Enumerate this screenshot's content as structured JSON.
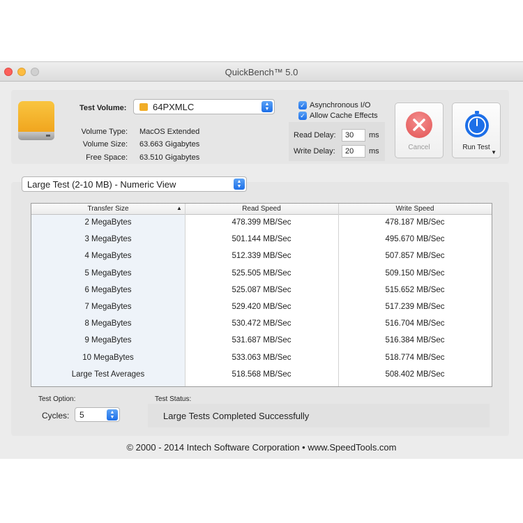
{
  "window": {
    "title": "QuickBench™ 5.0"
  },
  "volume": {
    "label": "Test Volume:",
    "selected": "64PXMLC",
    "type_label": "Volume Type:",
    "type_value": "MacOS Extended",
    "size_label": "Volume Size:",
    "size_value": "63.663 Gigabytes",
    "free_label": "Free Space:",
    "free_value": "63.510 Gigabytes"
  },
  "options": {
    "async_label": "Asynchronous I/O",
    "cache_label": "Allow Cache Effects",
    "async_checked": true,
    "cache_checked": true,
    "read_delay_label": "Read Delay:",
    "read_delay_value": "30",
    "write_delay_label": "Write Delay:",
    "write_delay_value": "20",
    "unit": "ms"
  },
  "buttons": {
    "cancel_label": "Cancel",
    "run_label": "Run Test"
  },
  "view_select": {
    "selected": "Large Test (2-10 MB) - Numeric View"
  },
  "table": {
    "headers": [
      "Transfer Size",
      "Read Speed",
      "Write Speed"
    ],
    "rows": [
      [
        "2 MegaBytes",
        "478.399 MB/Sec",
        "478.187 MB/Sec"
      ],
      [
        "3 MegaBytes",
        "501.144 MB/Sec",
        "495.670 MB/Sec"
      ],
      [
        "4 MegaBytes",
        "512.339 MB/Sec",
        "507.857 MB/Sec"
      ],
      [
        "5 MegaBytes",
        "525.505 MB/Sec",
        "509.150 MB/Sec"
      ],
      [
        "6 MegaBytes",
        "525.087 MB/Sec",
        "515.652 MB/Sec"
      ],
      [
        "7 MegaBytes",
        "529.420 MB/Sec",
        "517.239 MB/Sec"
      ],
      [
        "8 MegaBytes",
        "530.472 MB/Sec",
        "516.704 MB/Sec"
      ],
      [
        "9 MegaBytes",
        "531.687 MB/Sec",
        "516.384 MB/Sec"
      ],
      [
        "10 MegaBytes",
        "533.063 MB/Sec",
        "518.774 MB/Sec"
      ],
      [
        "Large Test Averages",
        "518.568 MB/Sec",
        "508.402 MB/Sec"
      ]
    ]
  },
  "test_option": {
    "label": "Test Option:",
    "cycles_label": "Cycles:",
    "cycles_value": "5"
  },
  "test_status": {
    "label": "Test Status:",
    "value": "Large Tests Completed Successfully"
  },
  "footer": {
    "text": "© 2000 - 2014 Intech Software Corporation • www.SpeedTools.com"
  },
  "colors": {
    "accent": "#1d6fe8",
    "drive": "#f1ad27",
    "cancel": "#e25454"
  }
}
